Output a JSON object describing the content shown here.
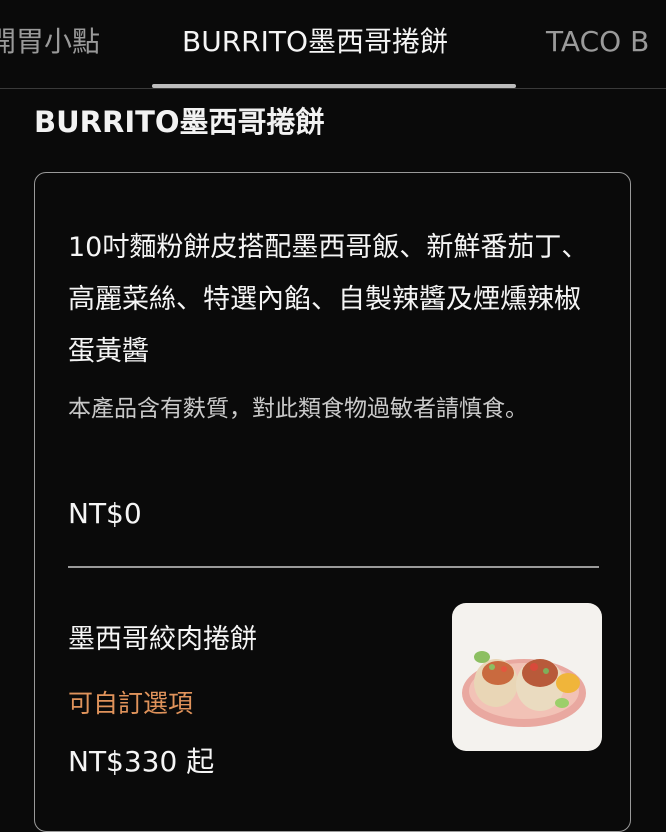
{
  "tabs": [
    {
      "label": "開胃小點"
    },
    {
      "label": "BURRITO墨西哥捲餅"
    },
    {
      "label": "TACO B"
    }
  ],
  "section": {
    "title": "BURRITO墨西哥捲餅"
  },
  "card": {
    "description": "10吋麵粉餅皮搭配墨西哥飯、新鮮番茄丁、高麗菜絲、特選內餡、自製辣醬及煙燻辣椒蛋黃醬",
    "notice": "本產品含有麩質，對此類食物過敏者請慎食。",
    "base_price": "NT$0",
    "items": [
      {
        "name": "墨西哥絞肉捲餅",
        "option_label": "可自訂選項",
        "price": "NT$330 起",
        "image_icon": "burrito-photo"
      }
    ]
  },
  "colors": {
    "background": "#0a0a0a",
    "accent_option": "#e0935b",
    "border": "#9a9a9a"
  }
}
